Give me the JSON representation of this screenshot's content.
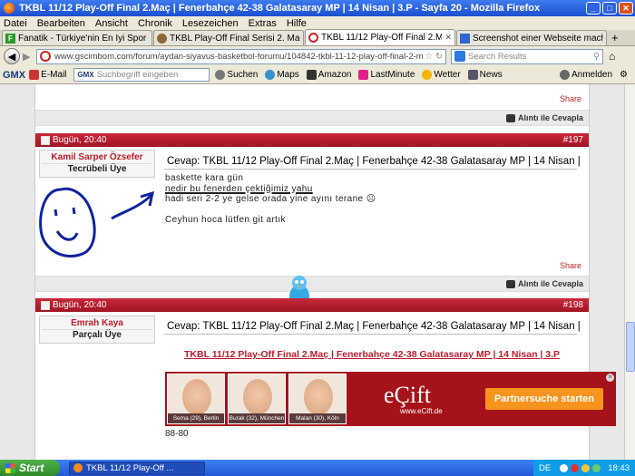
{
  "window": {
    "title": "TKBL 11/12 Play-Off Final 2.Maç | Fenerbahçe 42-38 Galatasaray MP | 14 Nisan | 3.P - Sayfa 20 - Mozilla Firefox"
  },
  "menu": [
    "Datei",
    "Bearbeiten",
    "Ansicht",
    "Chronik",
    "Lesezeichen",
    "Extras",
    "Hilfe"
  ],
  "tabs": [
    {
      "label": "Fanatik - Türkiye'nin En İyi Spor Sitesi",
      "icon": "F",
      "color": "#2a9a2a"
    },
    {
      "label": "TKBL Play-Off Final Serisi 2. Maç: Fener...",
      "icon": "",
      "color": "#555555"
    },
    {
      "label": "TKBL 11/12 Play-Off Final 2.Maç | Fener...",
      "icon": "",
      "color": "#cc2222"
    },
    {
      "label": "Screenshot einer Webseite machen | EX...",
      "icon": "",
      "color": "#3366cc"
    }
  ],
  "nav": {
    "url": "www.gscimbom.com/forum/aydan-siyavus-basketbol-forumu/104842-tkbl-11-12-play-off-final-2-mac-fenerbahce-42-38-galatasa",
    "search_placeholder": "Search Results"
  },
  "gmxbar": {
    "logo": "GMX",
    "email": "E-Mail",
    "search_brand": "GMX",
    "search_placeholder": "Suchbegriff eingeben",
    "search_btn": "Suchen",
    "items": [
      "Maps",
      "Amazon",
      "LastMinute",
      "Wetter",
      "News"
    ],
    "login": "Anmelden"
  },
  "page": {
    "share": "Share",
    "reply": "Alıntı ile Cevapla",
    "posts": [
      {
        "date": "Bugün, 20:40",
        "number": "#197",
        "user": "Kamil Sarper Özsefer",
        "rank": "Tecrübeli Üye",
        "title": "Cevap: TKBL 11/12 Play-Off Final 2.Maç | Fenerbahçe 42-38 Galatasaray MP | 14 Nisan |",
        "lines": [
          "baskette kara gün",
          "nedir bu fenerden çektiğimiz yahu",
          "hadi seri 2-2 ye gelse orada yine ayını terane ☹",
          "",
          "Ceyhun hoca lütfen git artık"
        ]
      },
      {
        "date": "Bugün, 20:40",
        "number": "#198",
        "user": "Emrah Kaya",
        "rank": "Parçalı Üye",
        "title": "Cevap: TKBL 11/12 Play-Off Final 2.Maç | Fenerbahçe 42-38 Galatasaray MP | 14 Nisan |",
        "link": "TKBL 11/12 Play-Off Final 2.Maç | Fenerbahçe 42-38 Galatasaray MP | 14 Nisan | 3.P",
        "after_ad": "88-80"
      }
    ],
    "ad": {
      "faces": [
        "Sema (29), Berlin",
        "Burak (32), München",
        "Malan (30), Köln"
      ],
      "logo": "eÇift",
      "url": "www.eCift.de",
      "button": "Partnersuche starten"
    }
  },
  "taskbar": {
    "start": "Start",
    "task": "TKBL 11/12 Play-Off ...",
    "lang": "DE",
    "clock": "18:43"
  }
}
